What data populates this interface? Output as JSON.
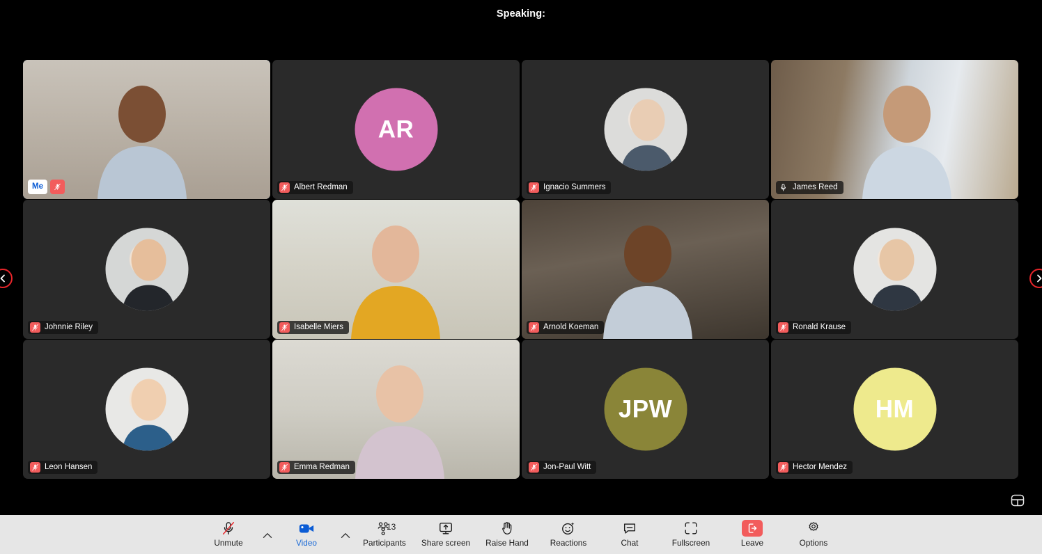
{
  "header": {
    "speaking_label": "Speaking:"
  },
  "nav": {
    "prev_icon": "chevron-left-icon",
    "next_icon": "chevron-right-icon",
    "layout_icon": "layout-view-icon"
  },
  "grid": {
    "participants": [
      {
        "name": "Me",
        "self": true,
        "mic": "muted",
        "media": "video",
        "video_style": "office-bookshelf",
        "avatar_type": "none",
        "initials": "",
        "avatar_color": "",
        "speaking": true
      },
      {
        "name": "Albert Redman",
        "self": false,
        "mic": "muted",
        "media": "avatar",
        "video_style": "",
        "avatar_type": "initials",
        "initials": "AR",
        "avatar_color": "#d170b0",
        "speaking": false
      },
      {
        "name": "Ignacio Summers",
        "self": false,
        "mic": "muted",
        "media": "avatar",
        "video_style": "",
        "avatar_type": "photo",
        "initials": "",
        "avatar_color": "#cfd2d4",
        "speaking": false
      },
      {
        "name": "James Reed",
        "self": false,
        "mic": "open",
        "media": "video",
        "video_style": "window-warm",
        "avatar_type": "none",
        "initials": "",
        "avatar_color": "",
        "speaking": false
      },
      {
        "name": "Johnnie Riley",
        "self": false,
        "mic": "muted",
        "media": "avatar",
        "video_style": "",
        "avatar_type": "photo",
        "initials": "",
        "avatar_color": "#d7d9d8",
        "speaking": false
      },
      {
        "name": "Isabelle Miers",
        "self": false,
        "mic": "muted",
        "media": "video",
        "video_style": "livingroom-yellow",
        "avatar_type": "none",
        "initials": "",
        "avatar_color": "",
        "speaking": false
      },
      {
        "name": "Arnold Koeman",
        "self": false,
        "mic": "muted",
        "media": "video",
        "video_style": "kitchen-dark",
        "avatar_type": "none",
        "initials": "",
        "avatar_color": "",
        "speaking": false
      },
      {
        "name": "Ronald Krause",
        "self": false,
        "mic": "muted",
        "media": "avatar",
        "video_style": "",
        "avatar_type": "photo",
        "initials": "",
        "avatar_color": "#e4e4e2",
        "speaking": false
      },
      {
        "name": "Leon Hansen",
        "self": false,
        "mic": "muted",
        "media": "avatar",
        "video_style": "",
        "avatar_type": "photo",
        "initials": "",
        "avatar_color": "#e8e8e6",
        "speaking": false
      },
      {
        "name": "Emma Redman",
        "self": false,
        "mic": "muted",
        "media": "video",
        "video_style": "home-office-light",
        "avatar_type": "none",
        "initials": "",
        "avatar_color": "",
        "speaking": false
      },
      {
        "name": "Jon-Paul Witt",
        "self": false,
        "mic": "muted",
        "media": "avatar",
        "video_style": "",
        "avatar_type": "initials",
        "initials": "JPW",
        "avatar_color": "#8a8538",
        "speaking": false
      },
      {
        "name": "Hector Mendez",
        "self": false,
        "mic": "muted",
        "media": "avatar",
        "video_style": "",
        "avatar_type": "initials",
        "initials": "HM",
        "avatar_color": "#eeea8d",
        "speaking": false
      }
    ]
  },
  "toolbar": {
    "items": [
      {
        "id": "audio",
        "label": "Unmute",
        "icon": "microphone-muted-icon",
        "active": false,
        "badge": ""
      },
      {
        "id": "video",
        "label": "Video",
        "icon": "camera-icon",
        "active": true,
        "badge": ""
      },
      {
        "id": "participants",
        "label": "Participants",
        "icon": "participants-icon",
        "active": false,
        "badge": "13"
      },
      {
        "id": "share",
        "label": "Share screen",
        "icon": "share-screen-icon",
        "active": false,
        "badge": ""
      },
      {
        "id": "raisehand",
        "label": "Raise Hand",
        "icon": "raise-hand-icon",
        "active": false,
        "badge": ""
      },
      {
        "id": "reactions",
        "label": "Reactions",
        "icon": "reactions-icon",
        "active": false,
        "badge": ""
      },
      {
        "id": "chat",
        "label": "Chat",
        "icon": "chat-icon",
        "active": false,
        "badge": ""
      },
      {
        "id": "fullscreen",
        "label": "Fullscreen",
        "icon": "fullscreen-icon",
        "active": false,
        "badge": ""
      },
      {
        "id": "leave",
        "label": "Leave",
        "icon": "leave-icon",
        "active": false,
        "badge": ""
      },
      {
        "id": "options",
        "label": "Options",
        "icon": "gear-icon",
        "active": false,
        "badge": ""
      }
    ],
    "participant_count": "13",
    "accent_color": "#1768d6",
    "leave_color": "#f25c5c"
  }
}
